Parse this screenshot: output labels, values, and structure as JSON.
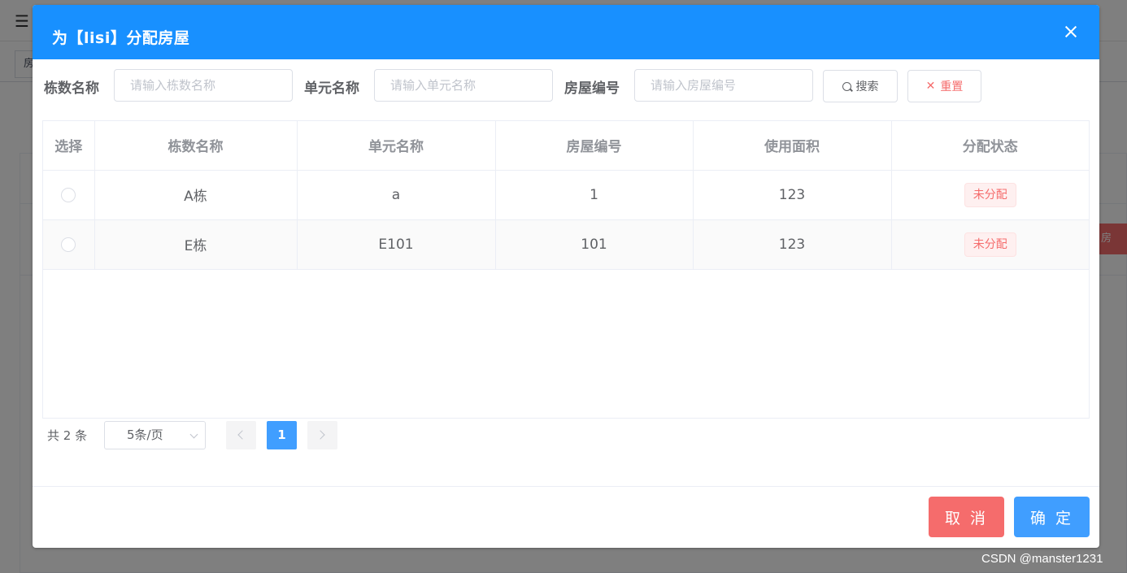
{
  "background": {
    "tab_label": "房",
    "assign_button_label": "房"
  },
  "dialog": {
    "title": "为【lisi】分配房屋"
  },
  "search": {
    "building_label": "栋数名称",
    "building_placeholder": "请输入栋数名称",
    "unit_label": "单元名称",
    "unit_placeholder": "请输入单元名称",
    "house_label": "房屋编号",
    "house_placeholder": "请输入房屋编号",
    "search_button": "搜索",
    "reset_button": "重置"
  },
  "table": {
    "columns": [
      "选择",
      "栋数名称",
      "单元名称",
      "房屋编号",
      "使用面积",
      "分配状态"
    ],
    "rows": [
      {
        "building": "A栋",
        "unit": "a",
        "house_no": "1",
        "area": "123",
        "status": "未分配"
      },
      {
        "building": "E栋",
        "unit": "E101",
        "house_no": "101",
        "area": "123",
        "status": "未分配"
      }
    ]
  },
  "pagination": {
    "total_text": "共 2 条",
    "page_size": "5条/页",
    "current_page": "1"
  },
  "footer": {
    "cancel": "取 消",
    "confirm": "确 定"
  },
  "watermark": "CSDN @manster1231",
  "colors": {
    "header_blue": "#1890ff",
    "primary": "#409eff",
    "danger": "#f56c6c"
  }
}
